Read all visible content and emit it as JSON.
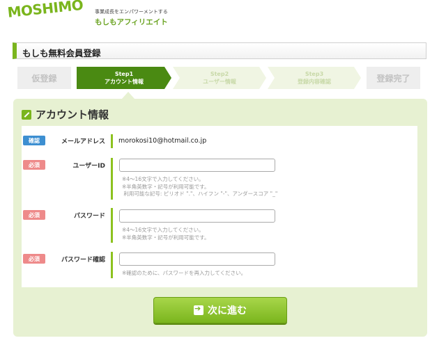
{
  "header": {
    "logo_text": "MOSHIMO",
    "tagline": "事業成長をエンパワーメントする",
    "brand": "もしもアフィリエイト"
  },
  "page": {
    "title": "もしも無料会員登録"
  },
  "steps": {
    "pre": "仮登録",
    "step1": {
      "num": "Step1",
      "label": "アカウント情報"
    },
    "step2": {
      "num": "Step2",
      "label": "ユーザー情報"
    },
    "step3": {
      "num": "Step3",
      "label": "登録内容確認"
    },
    "done": "登録完了",
    "active_step": "step1"
  },
  "form": {
    "title": "アカウント情報",
    "email": {
      "badge": "確認",
      "label": "メールアドレス",
      "value": "morokosi10@hotmail.co.jp"
    },
    "userid": {
      "badge": "必須",
      "label": "ユーザーID",
      "value": "",
      "hint": "※4～16文字で入力してください。\n※半角英数字・記号が利用可能です。\n 利用可能な記号: ピリオド \".\"、ハイフン \"-\"、アンダースコア \"_\""
    },
    "password": {
      "badge": "必須",
      "label": "パスワード",
      "value": "",
      "hint": "※4～16文字で入力してください。\n※半角英数字・記号が利用可能です。"
    },
    "password_confirm": {
      "badge": "必須",
      "label": "パスワード確認",
      "value": "",
      "hint": "※確認のために、パスワードを再入力してください。"
    },
    "next_button": "次に進む"
  },
  "colors": {
    "accent": "#7ab51d",
    "active_step": "#4a8a12",
    "confirm_badge": "#3d8fd1",
    "required_badge": "#ee8a8a"
  }
}
